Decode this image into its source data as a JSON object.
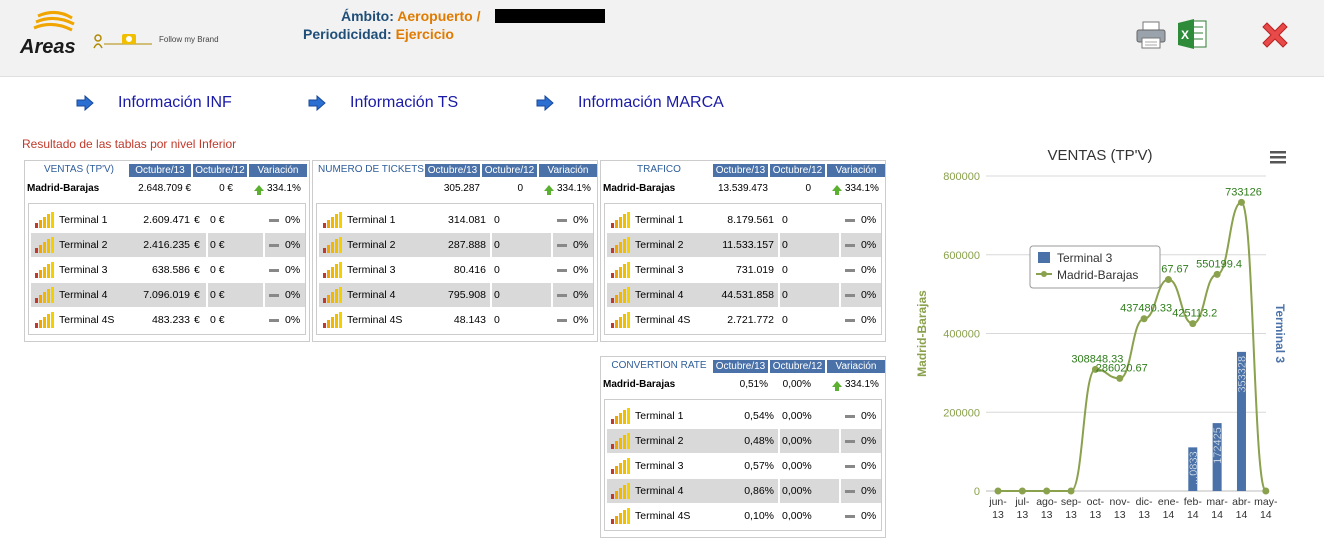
{
  "header": {
    "logo_text": "Areas",
    "brand_text": "Follow my Brand",
    "ambito_label": "Ámbito:",
    "ambito_value": "Aeropuerto /",
    "periodicidad_label": "Periodicidad:",
    "periodicidad_value": "Ejercicio",
    "icons": [
      "printer-icon",
      "excel-icon",
      "close-icon"
    ]
  },
  "nav": [
    {
      "label": "Información INF"
    },
    {
      "label": "Información TS"
    },
    {
      "label": "Información MARCA"
    }
  ],
  "subtitle": "Resultado de las tablas por nivel Inferior",
  "tables": [
    {
      "title": "VENTAS (TP'V)",
      "col1": "Octubre/13",
      "col2": "Octubre/12",
      "col3": "Variación",
      "summary": {
        "name": "Madrid-Barajas",
        "v1": "2.648.709  €",
        "v2": "0  €",
        "var": "334.1%"
      },
      "rows": [
        {
          "name": "Terminal 1",
          "v1": "2.609.471",
          "u1": "€",
          "v2": "0 €",
          "pct": "0%"
        },
        {
          "name": "Terminal 2",
          "v1": "2.416.235",
          "u1": "€",
          "v2": "0 €",
          "pct": "0%"
        },
        {
          "name": "Terminal 3",
          "v1": "638.586",
          "u1": "€",
          "v2": "0 €",
          "pct": "0%"
        },
        {
          "name": "Terminal 4",
          "v1": "7.096.019",
          "u1": "€",
          "v2": "0 €",
          "pct": "0%"
        },
        {
          "name": "Terminal 4S",
          "v1": "483.233",
          "u1": "€",
          "v2": "0 €",
          "pct": "0%"
        }
      ]
    },
    {
      "title": "NUMERO DE TICKETS",
      "col1": "Octubre/13",
      "col2": "Octubre/12",
      "col3": "Variación",
      "summary": {
        "name": "",
        "v1": "305.287",
        "v2": "0",
        "var": "334.1%"
      },
      "rows": [
        {
          "name": "Terminal 1",
          "v1": "314.081",
          "u1": "",
          "v2": "0",
          "pct": "0%"
        },
        {
          "name": "Terminal 2",
          "v1": "287.888",
          "u1": "",
          "v2": "0",
          "pct": "0%"
        },
        {
          "name": "Terminal 3",
          "v1": "80.416",
          "u1": "",
          "v2": "0",
          "pct": "0%"
        },
        {
          "name": "Terminal 4",
          "v1": "795.908",
          "u1": "",
          "v2": "0",
          "pct": "0%"
        },
        {
          "name": "Terminal 4S",
          "v1": "48.143",
          "u1": "",
          "v2": "0",
          "pct": "0%"
        }
      ]
    },
    {
      "title": "TRAFICO",
      "col1": "Octubre/13",
      "col2": "Octubre/12",
      "col3": "Variación",
      "summary": {
        "name": "Madrid-Barajas",
        "v1": "13.539.473",
        "v2": "0",
        "var": "334.1%"
      },
      "rows": [
        {
          "name": "Terminal 1",
          "v1": "8.179.561",
          "u1": "",
          "v2": "0",
          "pct": "0%"
        },
        {
          "name": "Terminal 2",
          "v1": "11.533.157",
          "u1": "",
          "v2": "0",
          "pct": "0%"
        },
        {
          "name": "Terminal 3",
          "v1": "731.019",
          "u1": "",
          "v2": "0",
          "pct": "0%"
        },
        {
          "name": "Terminal 4",
          "v1": "44.531.858",
          "u1": "",
          "v2": "0",
          "pct": "0%"
        },
        {
          "name": "Terminal 4S",
          "v1": "2.721.772",
          "u1": "",
          "v2": "0",
          "pct": "0%"
        }
      ]
    },
    {
      "title": "CONVERTION RATE",
      "col1": "Octubre/13",
      "col2": "Octubre/12",
      "col3": "Variación",
      "summary": {
        "name": "Madrid-Barajas",
        "v1": "0,51%",
        "v2": "0,00%",
        "var": "334.1%"
      },
      "rows": [
        {
          "name": "Terminal 1",
          "v1": "0,54%",
          "u1": "",
          "v2": "0,00%",
          "pct": "0%"
        },
        {
          "name": "Terminal 2",
          "v1": "0,48%",
          "u1": "",
          "v2": "0,00%",
          "pct": "0%"
        },
        {
          "name": "Terminal 3",
          "v1": "0,57%",
          "u1": "",
          "v2": "0,00%",
          "pct": "0%"
        },
        {
          "name": "Terminal 4",
          "v1": "0,86%",
          "u1": "",
          "v2": "0,00%",
          "pct": "0%"
        },
        {
          "name": "Terminal 4S",
          "v1": "0,10%",
          "u1": "",
          "v2": "0,00%",
          "pct": "0%"
        }
      ]
    }
  ],
  "chart_data": {
    "type": "line",
    "title": "VENTAS (TP'V)",
    "ylabel_left": "Madrid-Barajas",
    "ylabel_right": "Terminal 3",
    "yticks": [
      "0",
      "200000",
      "400000",
      "600000",
      "800000"
    ],
    "ylim": [
      0,
      800000
    ],
    "categories": [
      "jun-13",
      "jul-13",
      "ago-13",
      "sep-13",
      "oct-13",
      "nov-13",
      "dic-13",
      "ene-14",
      "feb-14",
      "mar-14",
      "abr-14",
      "may-14"
    ],
    "series": [
      {
        "name": "Madrid-Barajas",
        "type": "line",
        "color": "#8aa14d",
        "values": [
          0,
          0,
          0,
          0,
          308848.33,
          286020.67,
          437480.33,
          537000,
          425113.2,
          550199.4,
          733126,
          0
        ],
        "labels": [
          "",
          "",
          "",
          "",
          "308848.33",
          "286020.67",
          "437480.33",
          "...67.67",
          "425113.2",
          "550199.4",
          "733126",
          ""
        ]
      },
      {
        "name": "Terminal 3",
        "type": "bar",
        "color": "#4a72a8",
        "values": [
          0,
          0,
          0,
          0,
          0,
          0,
          0,
          0,
          110833,
          172425,
          353328,
          0
        ],
        "labels": [
          "",
          "",
          "",
          "",
          "",
          "",
          "",
          "",
          "...0833",
          "172425",
          "353328",
          ""
        ]
      }
    ],
    "legend": {
      "position": "top-left inside",
      "items": [
        "Terminal 3",
        "Madrid-Barajas"
      ]
    },
    "menu_icon": "hamburger-menu-icon",
    "grid": true
  }
}
